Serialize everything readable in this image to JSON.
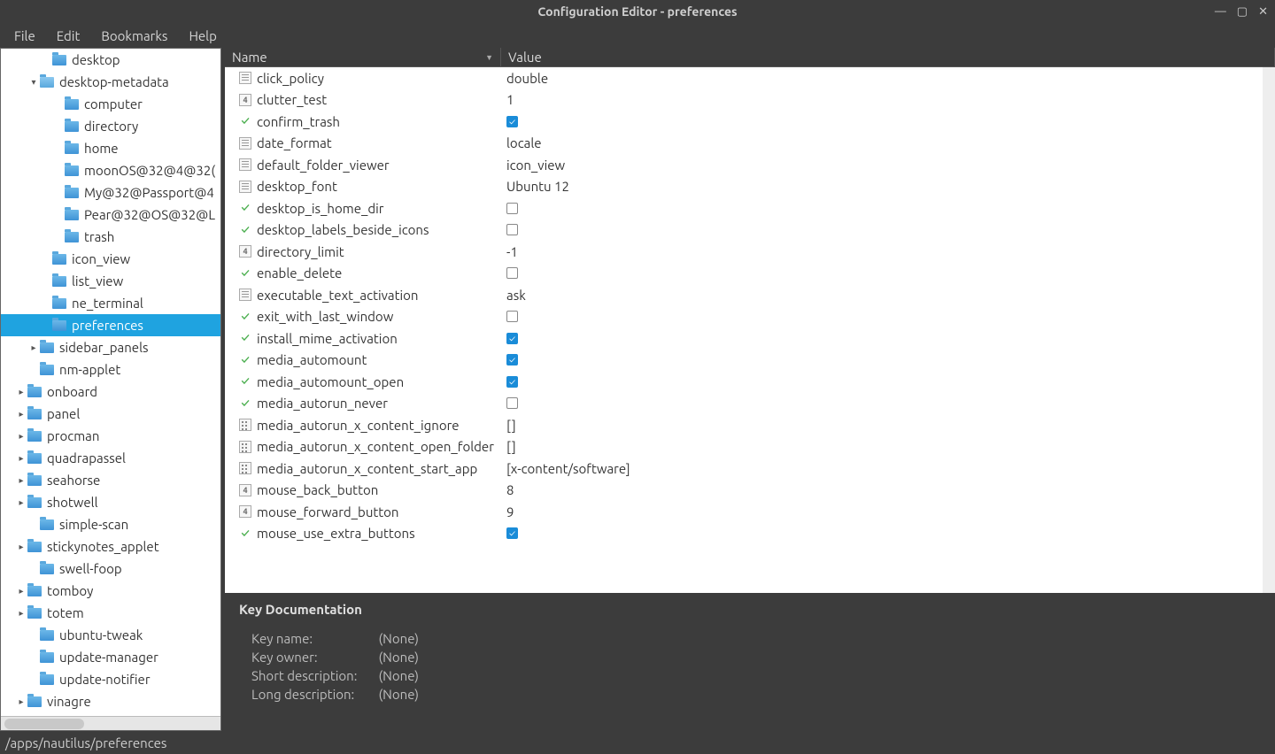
{
  "window": {
    "title": "Configuration Editor - preferences"
  },
  "menu": {
    "file": "File",
    "edit": "Edit",
    "bookmarks": "Bookmarks",
    "help": "Help"
  },
  "tree": [
    {
      "label": "desktop",
      "indent": 44,
      "expander": "",
      "open": false
    },
    {
      "label": "desktop-metadata",
      "indent": 30,
      "expander": "▾",
      "open": true
    },
    {
      "label": "computer",
      "indent": 58,
      "expander": ""
    },
    {
      "label": "directory",
      "indent": 58,
      "expander": ""
    },
    {
      "label": "home",
      "indent": 58,
      "expander": ""
    },
    {
      "label": "moonOS@32@4@32(",
      "indent": 58,
      "expander": ""
    },
    {
      "label": "My@32@Passport@4",
      "indent": 58,
      "expander": ""
    },
    {
      "label": "Pear@32@OS@32@L",
      "indent": 58,
      "expander": ""
    },
    {
      "label": "trash",
      "indent": 58,
      "expander": ""
    },
    {
      "label": "icon_view",
      "indent": 44,
      "expander": ""
    },
    {
      "label": "list_view",
      "indent": 44,
      "expander": ""
    },
    {
      "label": "ne_terminal",
      "indent": 44,
      "expander": ""
    },
    {
      "label": "preferences",
      "indent": 44,
      "expander": "",
      "selected": true
    },
    {
      "label": "sidebar_panels",
      "indent": 30,
      "expander": "▸"
    },
    {
      "label": "nm-applet",
      "indent": 30,
      "expander": ""
    },
    {
      "label": "onboard",
      "indent": 16,
      "expander": "▸"
    },
    {
      "label": "panel",
      "indent": 16,
      "expander": "▸"
    },
    {
      "label": "procman",
      "indent": 16,
      "expander": "▸"
    },
    {
      "label": "quadrapassel",
      "indent": 16,
      "expander": "▸"
    },
    {
      "label": "seahorse",
      "indent": 16,
      "expander": "▸"
    },
    {
      "label": "shotwell",
      "indent": 16,
      "expander": "▸"
    },
    {
      "label": "simple-scan",
      "indent": 30,
      "expander": ""
    },
    {
      "label": "stickynotes_applet",
      "indent": 16,
      "expander": "▸"
    },
    {
      "label": "swell-foop",
      "indent": 30,
      "expander": ""
    },
    {
      "label": "tomboy",
      "indent": 16,
      "expander": "▸"
    },
    {
      "label": "totem",
      "indent": 16,
      "expander": "▸"
    },
    {
      "label": "ubuntu-tweak",
      "indent": 30,
      "expander": ""
    },
    {
      "label": "update-manager",
      "indent": 30,
      "expander": ""
    },
    {
      "label": "update-notifier",
      "indent": 30,
      "expander": ""
    },
    {
      "label": "vinagre",
      "indent": 16,
      "expander": "▸"
    }
  ],
  "columns": {
    "name": "Name",
    "value": "Value"
  },
  "rows": [
    {
      "type": "str",
      "name": "click_policy",
      "value": "double"
    },
    {
      "type": "int",
      "name": "clutter_test",
      "value": "1"
    },
    {
      "type": "bool",
      "name": "confirm_trash",
      "checked": true
    },
    {
      "type": "str",
      "name": "date_format",
      "value": "locale"
    },
    {
      "type": "str",
      "name": "default_folder_viewer",
      "value": "icon_view"
    },
    {
      "type": "str",
      "name": "desktop_font",
      "value": "Ubuntu 12"
    },
    {
      "type": "bool",
      "name": "desktop_is_home_dir",
      "checked": false
    },
    {
      "type": "bool",
      "name": "desktop_labels_beside_icons",
      "checked": false
    },
    {
      "type": "int",
      "name": "directory_limit",
      "value": "-1"
    },
    {
      "type": "bool",
      "name": "enable_delete",
      "checked": false
    },
    {
      "type": "str",
      "name": "executable_text_activation",
      "value": "ask"
    },
    {
      "type": "bool",
      "name": "exit_with_last_window",
      "checked": false
    },
    {
      "type": "bool",
      "name": "install_mime_activation",
      "checked": true
    },
    {
      "type": "bool",
      "name": "media_automount",
      "checked": true
    },
    {
      "type": "bool",
      "name": "media_automount_open",
      "checked": true
    },
    {
      "type": "bool",
      "name": "media_autorun_never",
      "checked": false
    },
    {
      "type": "list",
      "name": "media_autorun_x_content_ignore",
      "value": "[]"
    },
    {
      "type": "list",
      "name": "media_autorun_x_content_open_folder",
      "value": "[]"
    },
    {
      "type": "list",
      "name": "media_autorun_x_content_start_app",
      "value": "[x-content/software]"
    },
    {
      "type": "int",
      "name": "mouse_back_button",
      "value": "8"
    },
    {
      "type": "int",
      "name": "mouse_forward_button",
      "value": "9"
    },
    {
      "type": "bool",
      "name": "mouse_use_extra_buttons",
      "checked": true
    }
  ],
  "doc": {
    "header": "Key Documentation",
    "keyname_label": "Key name:",
    "keyname": "(None)",
    "keyowner_label": "Key owner:",
    "keyowner": "(None)",
    "shortdesc_label": "Short description:",
    "shortdesc": "(None)",
    "longdesc_label": "Long description:",
    "longdesc": "(None)"
  },
  "statusbar": "/apps/nautilus/preferences"
}
